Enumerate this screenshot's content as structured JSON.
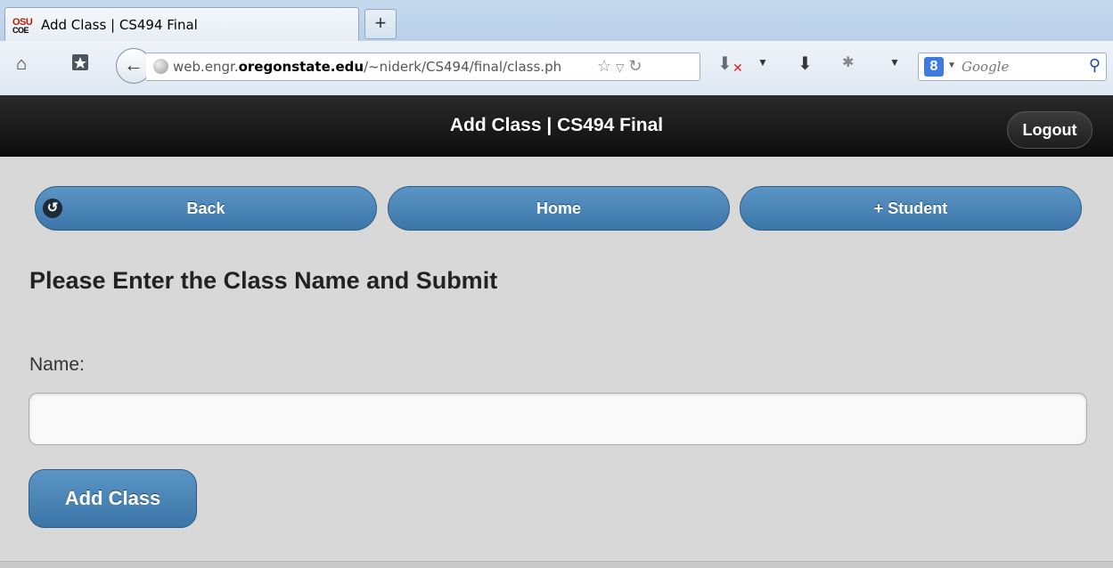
{
  "browser": {
    "tab_title": "Add Class | CS494 Final",
    "favicon_line1": "OSU",
    "favicon_line2": "COE",
    "new_tab": "+",
    "url_prefix": "web.engr.",
    "url_domain": "oregonstate.edu",
    "url_path": "/~niderk/CS494/final/class.ph",
    "search_engine_badge": "8",
    "search_placeholder": "Google"
  },
  "header": {
    "title": "Add Class | CS494 Final",
    "logout_label": "Logout"
  },
  "nav": {
    "back_label": "Back",
    "home_label": "Home",
    "student_label": "+ Student"
  },
  "form": {
    "heading": "Please Enter the Class Name and Submit",
    "name_label": "Name:",
    "name_value": "",
    "submit_label": "Add Class"
  },
  "colors": {
    "button_blue": "#4a86b8",
    "header_black": "#111111",
    "page_bg": "#d8d8d8"
  }
}
